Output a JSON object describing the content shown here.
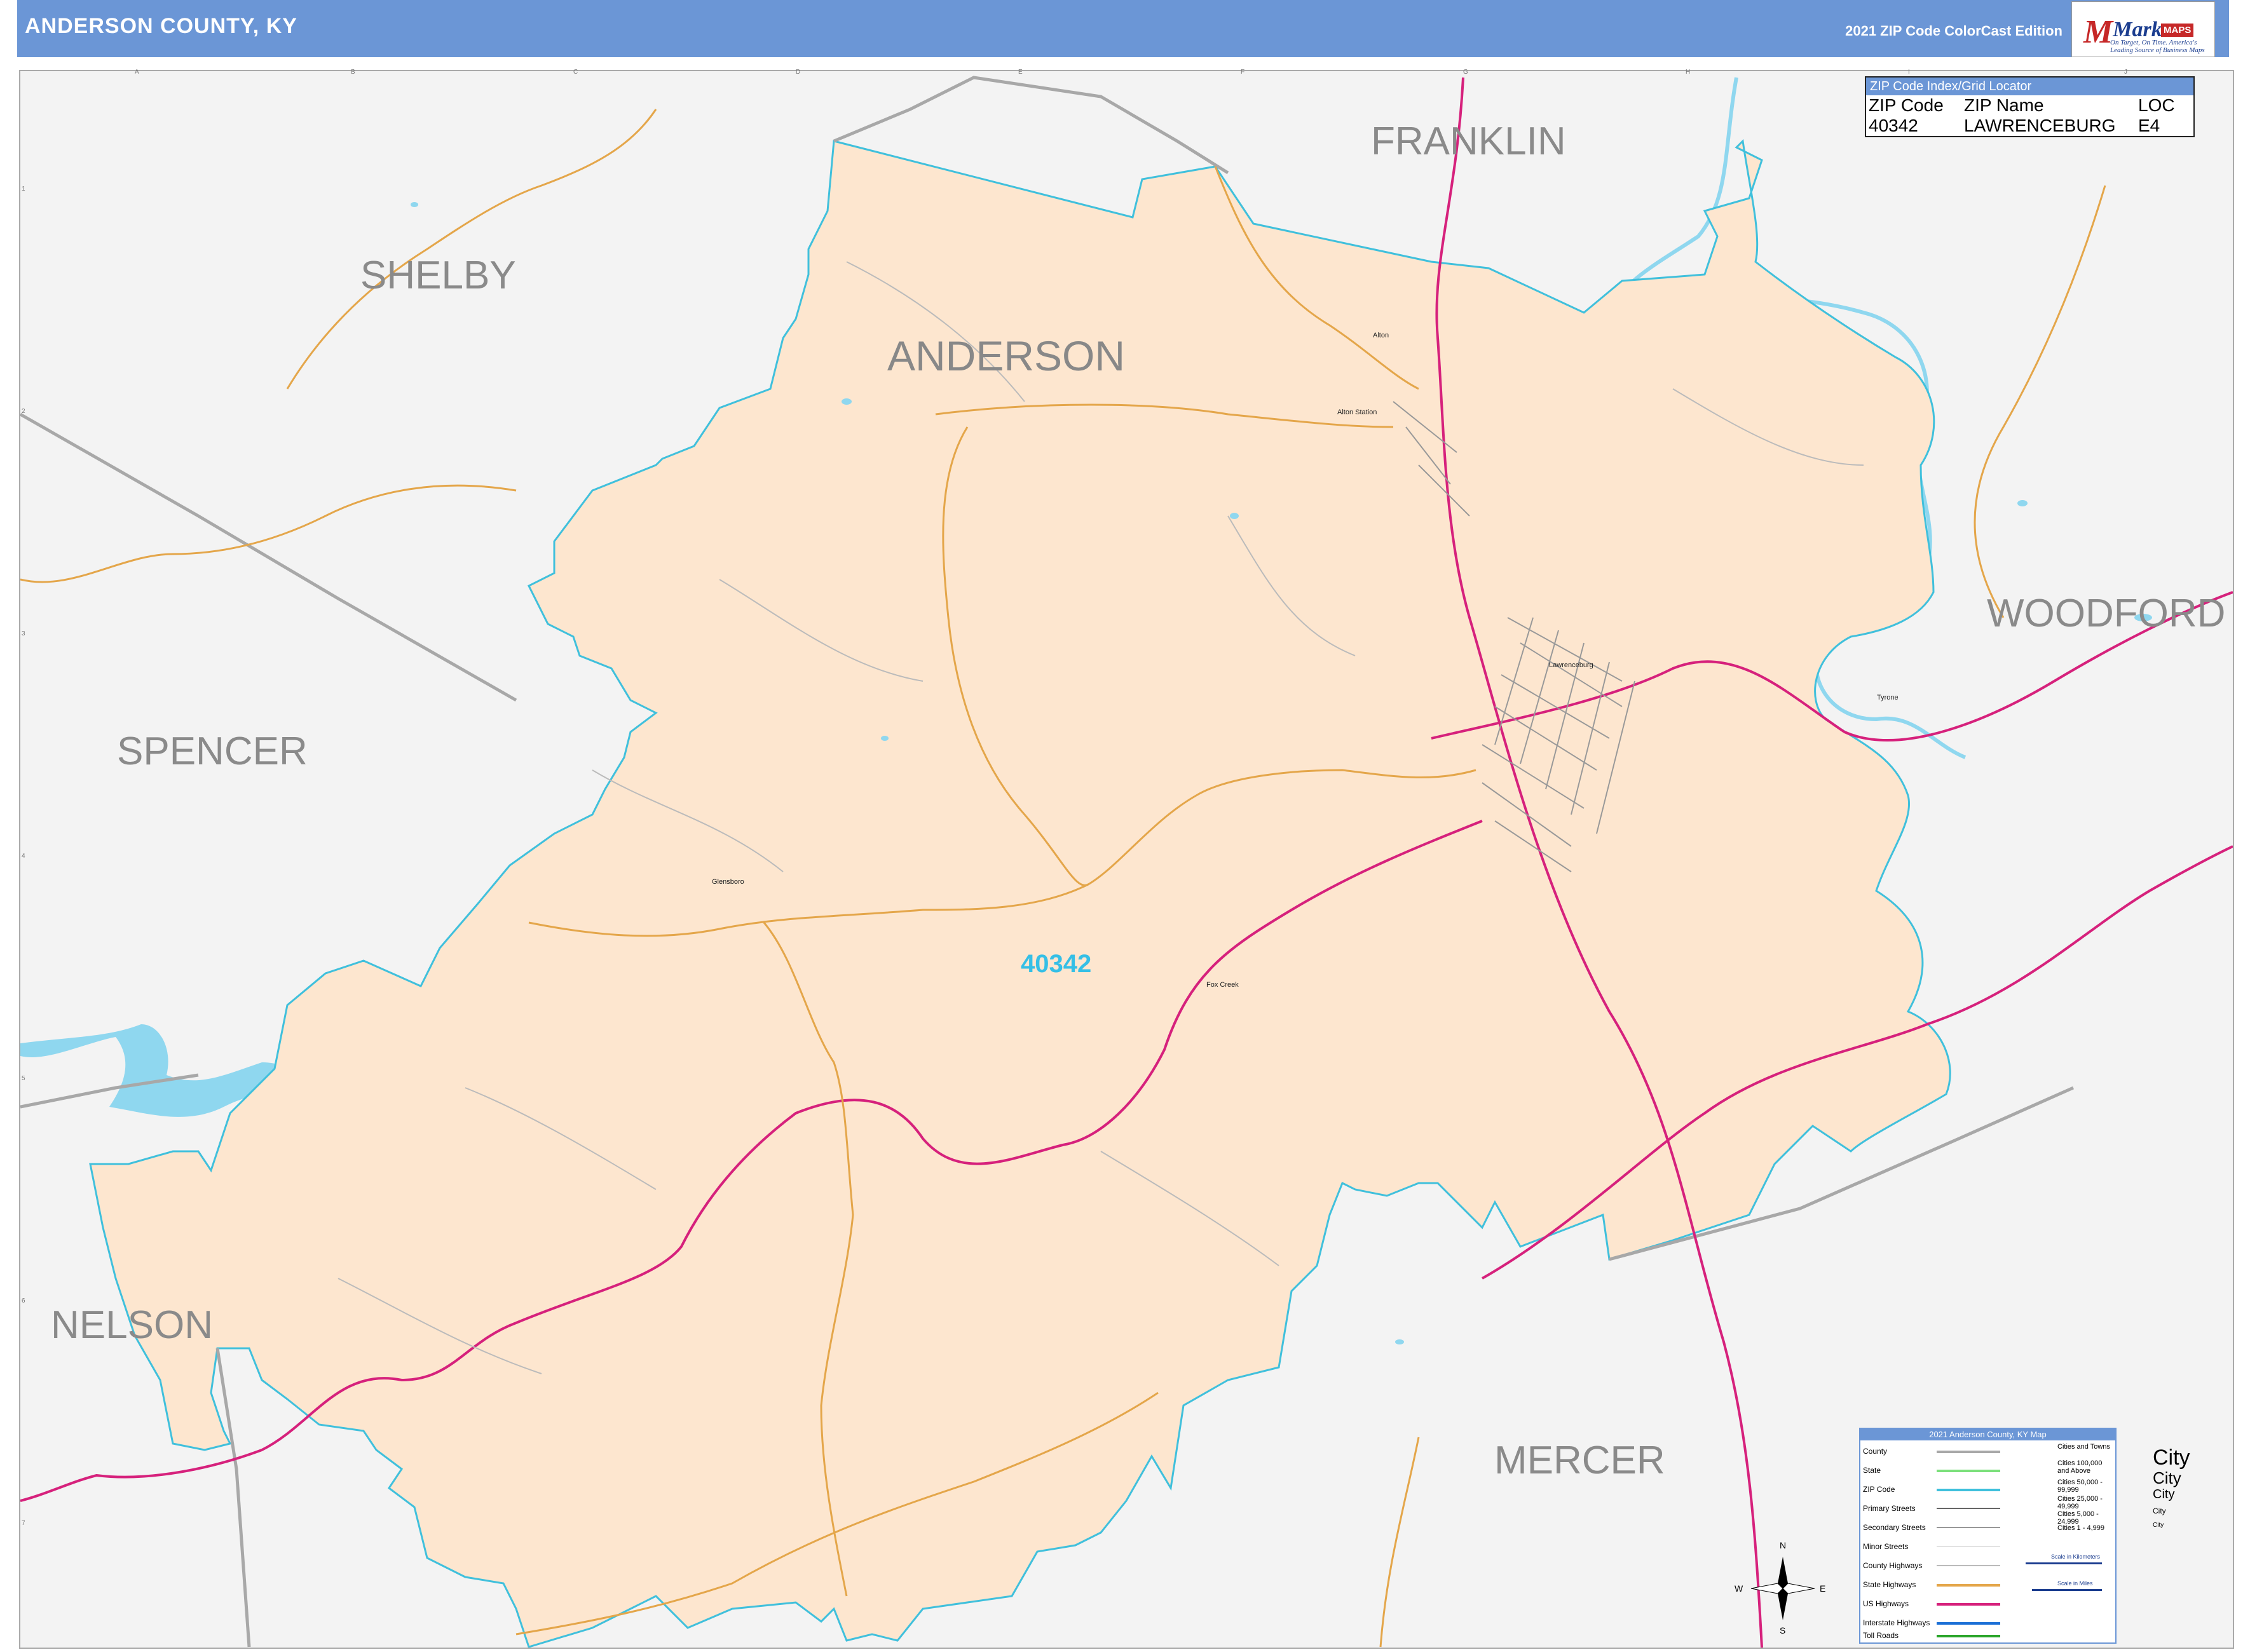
{
  "header": {
    "title": "ANDERSON COUNTY, KY",
    "edition": "2021 ZIP Code ColorCast Edition",
    "logo_brand": "Market",
    "logo_maps": "MAPS",
    "logo_slogan": "On Target, On Time. America's Leading Source of Business Maps"
  },
  "map": {
    "county_label": "ANDERSON",
    "zip_label": "40342",
    "regions": [
      "SHELBY",
      "FRANKLIN",
      "WOODFORD",
      "SPENCER",
      "NELSON",
      "MERCER"
    ],
    "places": [
      "Alton",
      "Alton Station",
      "Lawrenceburg",
      "Tyrone",
      "Glensboro",
      "Fox Creek"
    ],
    "colors": {
      "zip_fill": "#fde6cf",
      "zip_border": "#40c0dc",
      "county_border": "#a8a8a8",
      "us_highway": "#d6217c",
      "state_highway": "#e4a64a",
      "water": "#8fd7ef"
    },
    "grid_columns": [
      "A",
      "B",
      "C",
      "D",
      "E",
      "F",
      "G",
      "H",
      "I",
      "J"
    ],
    "grid_rows": [
      "1",
      "2",
      "3",
      "4",
      "5",
      "6",
      "7"
    ]
  },
  "zip_index": {
    "title": "ZIP Code Index/Grid Locator",
    "headers": [
      "ZIP Code",
      "ZIP Name",
      "LOC"
    ],
    "rows": [
      [
        "40342",
        "LAWRENCEBURG",
        "E4"
      ]
    ]
  },
  "legend": {
    "title": "2021 Anderson County, KY Map",
    "items": [
      "County",
      "State",
      "ZIP Code",
      "Primary Streets",
      "Secondary Streets",
      "Minor Streets",
      "County Highways",
      "State Highways",
      "US Highways",
      "Interstate Highways",
      "Toll Roads"
    ],
    "city_header": "Cities and Towns",
    "city_ranges": [
      "Cities 100,000 and Above",
      "Cities 50,000 - 99,999",
      "Cities 25,000 - 49,999",
      "Cities 5,000 - 24,999",
      "Cities 1 - 4,999"
    ],
    "city_samples": [
      "City",
      "City",
      "City",
      "City",
      "City"
    ],
    "scale_km": "Scale in Kilometers",
    "scale_miles": "Scale in Miles"
  },
  "compass": {
    "n": "N",
    "s": "S",
    "e": "E",
    "w": "W"
  }
}
